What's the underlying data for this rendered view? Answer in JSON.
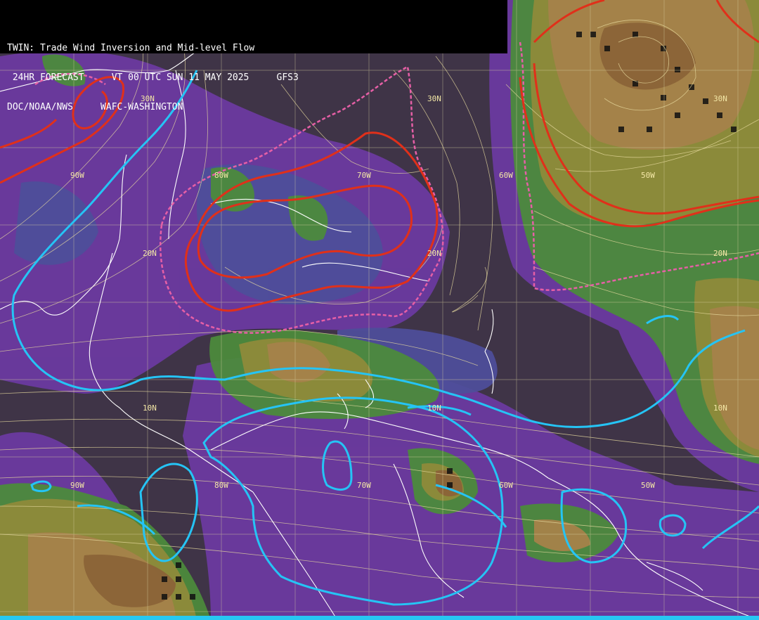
{
  "header": {
    "line1": "TWIN: Trade Wind Inversion and Mid-level Flow",
    "line2": " 24HR FORECAST     VT 00 UTC SUN 11 MAY 2025     GFS3",
    "line3": "DOC/NOAA/NWS     WAFC-WASHINGTON"
  },
  "labels": {
    "lat": [
      "30N",
      "30N",
      "30N",
      "20N",
      "20N",
      "20N",
      "10N",
      "10N",
      "10N"
    ],
    "lon": [
      "90W",
      "80W",
      "70W",
      "60W",
      "50W",
      "90W",
      "80W",
      "70W",
      "60W",
      "50W"
    ]
  },
  "colors": {
    "background": "#3f3447",
    "purple": "#6b3aa0",
    "blue_band": "#4e4e9a",
    "green": "#4c8a3c",
    "olive": "#8e8a3a",
    "tan": "#a5824a",
    "brown": "#8b6338",
    "streamline": "#e9dca0",
    "contour_red": "#e0301a",
    "contour_pink": "#e65fa6",
    "contour_cyan": "#25c4f5",
    "coast": "#ffffff",
    "grid": "#d8d0a0"
  }
}
